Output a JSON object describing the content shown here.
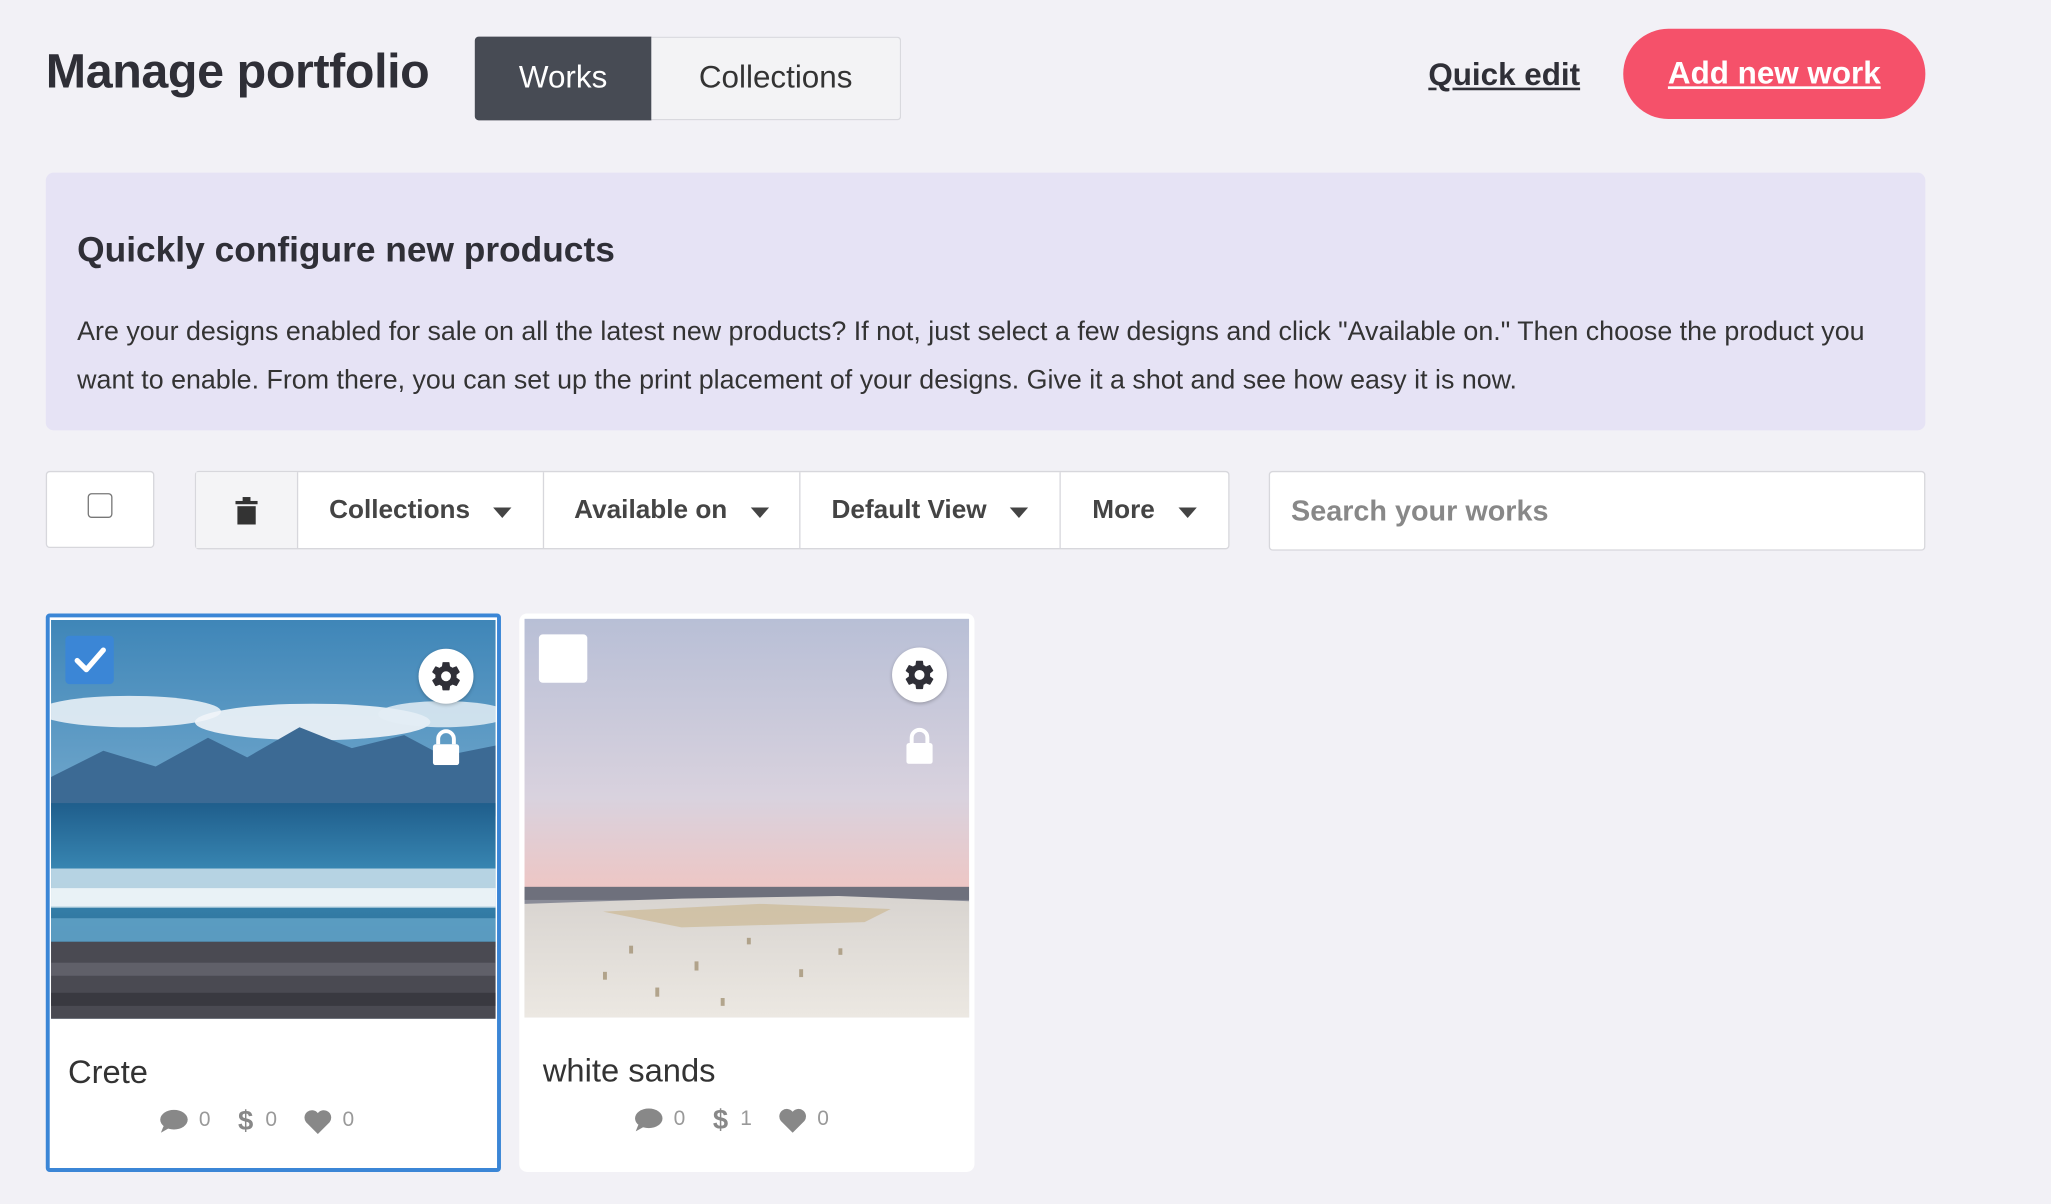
{
  "header": {
    "title": "Manage portfolio",
    "tabs": [
      {
        "label": "Works",
        "active": true
      },
      {
        "label": "Collections",
        "active": false
      }
    ],
    "quick_edit": "Quick edit",
    "add_new": "Add new work"
  },
  "banner": {
    "heading": "Quickly configure new products",
    "body": "Are your designs enabled for sale on all the latest new products? If not, just select a few designs and click \"Available on.\" Then choose the product you want to enable. From there, you can set up the print placement of your designs. Give it a shot and see how easy it is now."
  },
  "toolbar": {
    "collections": "Collections",
    "available_on": "Available on",
    "default_view": "Default View",
    "more": "More",
    "search_placeholder": "Search your works"
  },
  "works": [
    {
      "title": "Crete",
      "selected": true,
      "comments": "0",
      "sales": "0",
      "likes": "0"
    },
    {
      "title": "white sands",
      "selected": false,
      "comments": "0",
      "sales": "1",
      "likes": "0"
    }
  ],
  "colors": {
    "accent": "#f5516a",
    "active_tab": "#474b54",
    "selection": "#3b86d6",
    "banner_bg": "#e6e3f5",
    "page_bg": "#f2f1f6"
  },
  "icons": [
    "trash-icon",
    "chevron-down-icon",
    "gear-icon",
    "lock-icon",
    "comment-icon",
    "dollar-icon",
    "heart-icon",
    "check-icon"
  ]
}
